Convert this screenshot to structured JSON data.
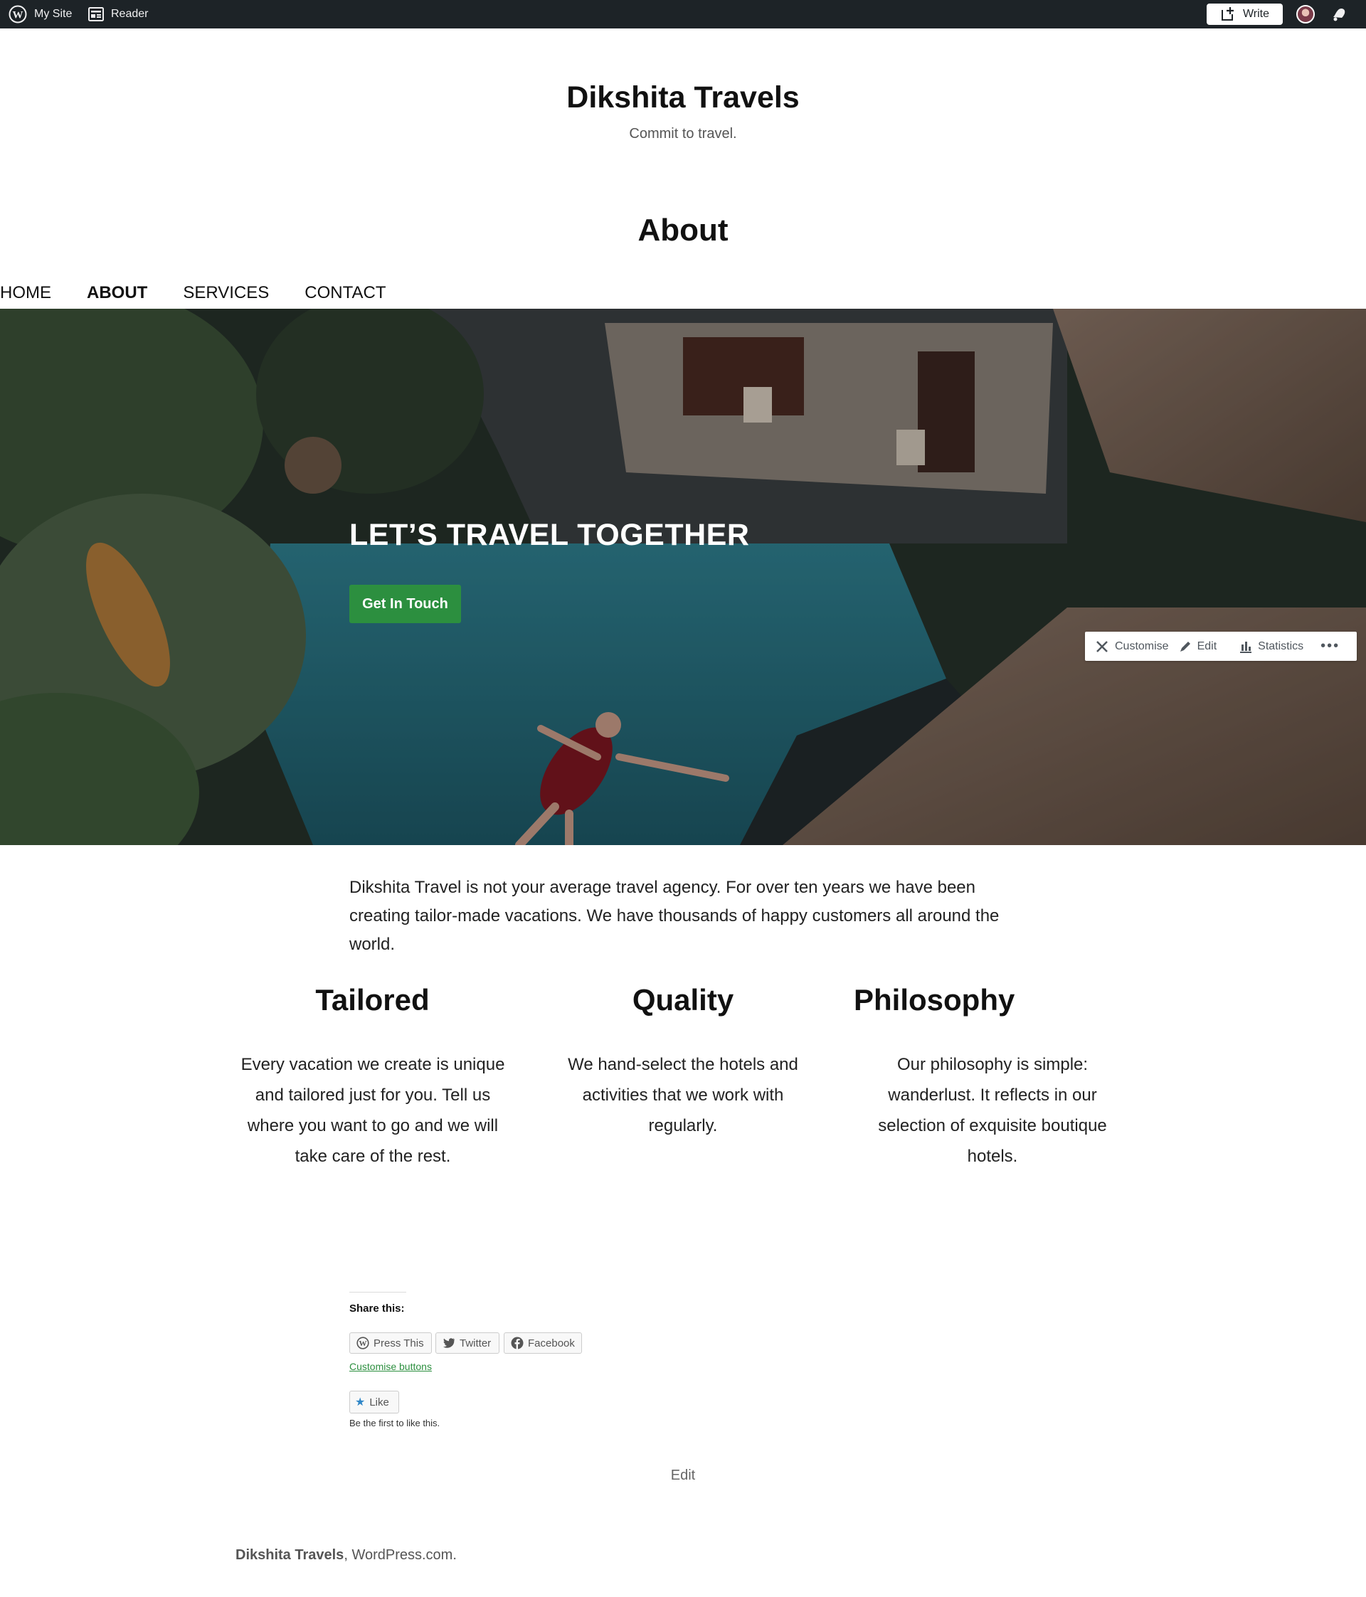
{
  "admin_bar": {
    "my_site_label": "My Site",
    "reader_label": "Reader",
    "write_label": "Write"
  },
  "site": {
    "title": "Dikshita Travels",
    "tagline": "Commit to travel."
  },
  "page": {
    "title": "About"
  },
  "nav": {
    "items": [
      {
        "label": "HOME",
        "active": false
      },
      {
        "label": "ABOUT",
        "active": true
      },
      {
        "label": "SERVICES",
        "active": false
      },
      {
        "label": "CONTACT",
        "active": false
      }
    ]
  },
  "hero": {
    "title": "LET’S TRAVEL TOGETHER",
    "button_label": "Get In Touch"
  },
  "float_toolbar": {
    "customise": "Customise",
    "edit": "Edit",
    "statistics": "Statistics",
    "more": "•••"
  },
  "content": {
    "intro": "Dikshita Travel is not your average travel agency. For over ten years we have been creating tailor-made vacations. We have thousands of happy customers all around the world.",
    "columns": [
      {
        "heading": "Tailored",
        "lines": [
          "Every vacation we create is unique",
          "and tailored just for you. Tell us",
          "where you want to go and we will",
          "take care of the rest."
        ]
      },
      {
        "heading": "Quality",
        "lines": [
          "We hand-select the hotels and",
          "activities that we work with",
          "regularly."
        ]
      },
      {
        "heading": "Philosophy",
        "lines": [
          "Our philosophy is simple:",
          "wanderlust. It reflects in our",
          "selection of exquisite boutique",
          "hotels."
        ]
      }
    ]
  },
  "share": {
    "title": "Share this:",
    "buttons": [
      {
        "label": "Press This",
        "icon": "wordpress-icon"
      },
      {
        "label": "Twitter",
        "icon": "twitter-icon"
      },
      {
        "label": "Facebook",
        "icon": "facebook-icon"
      }
    ],
    "customise_link": "Customise buttons",
    "like_label": "Like",
    "like_note": "Be the first to like this."
  },
  "edit_link": "Edit",
  "footer": {
    "site_name": "Dikshita Travels",
    "separator": ", ",
    "platform": "WordPress.com."
  },
  "colors": {
    "admin_bar": "#1d2327",
    "accent_green": "#2c8f3f",
    "text": "#111111"
  }
}
